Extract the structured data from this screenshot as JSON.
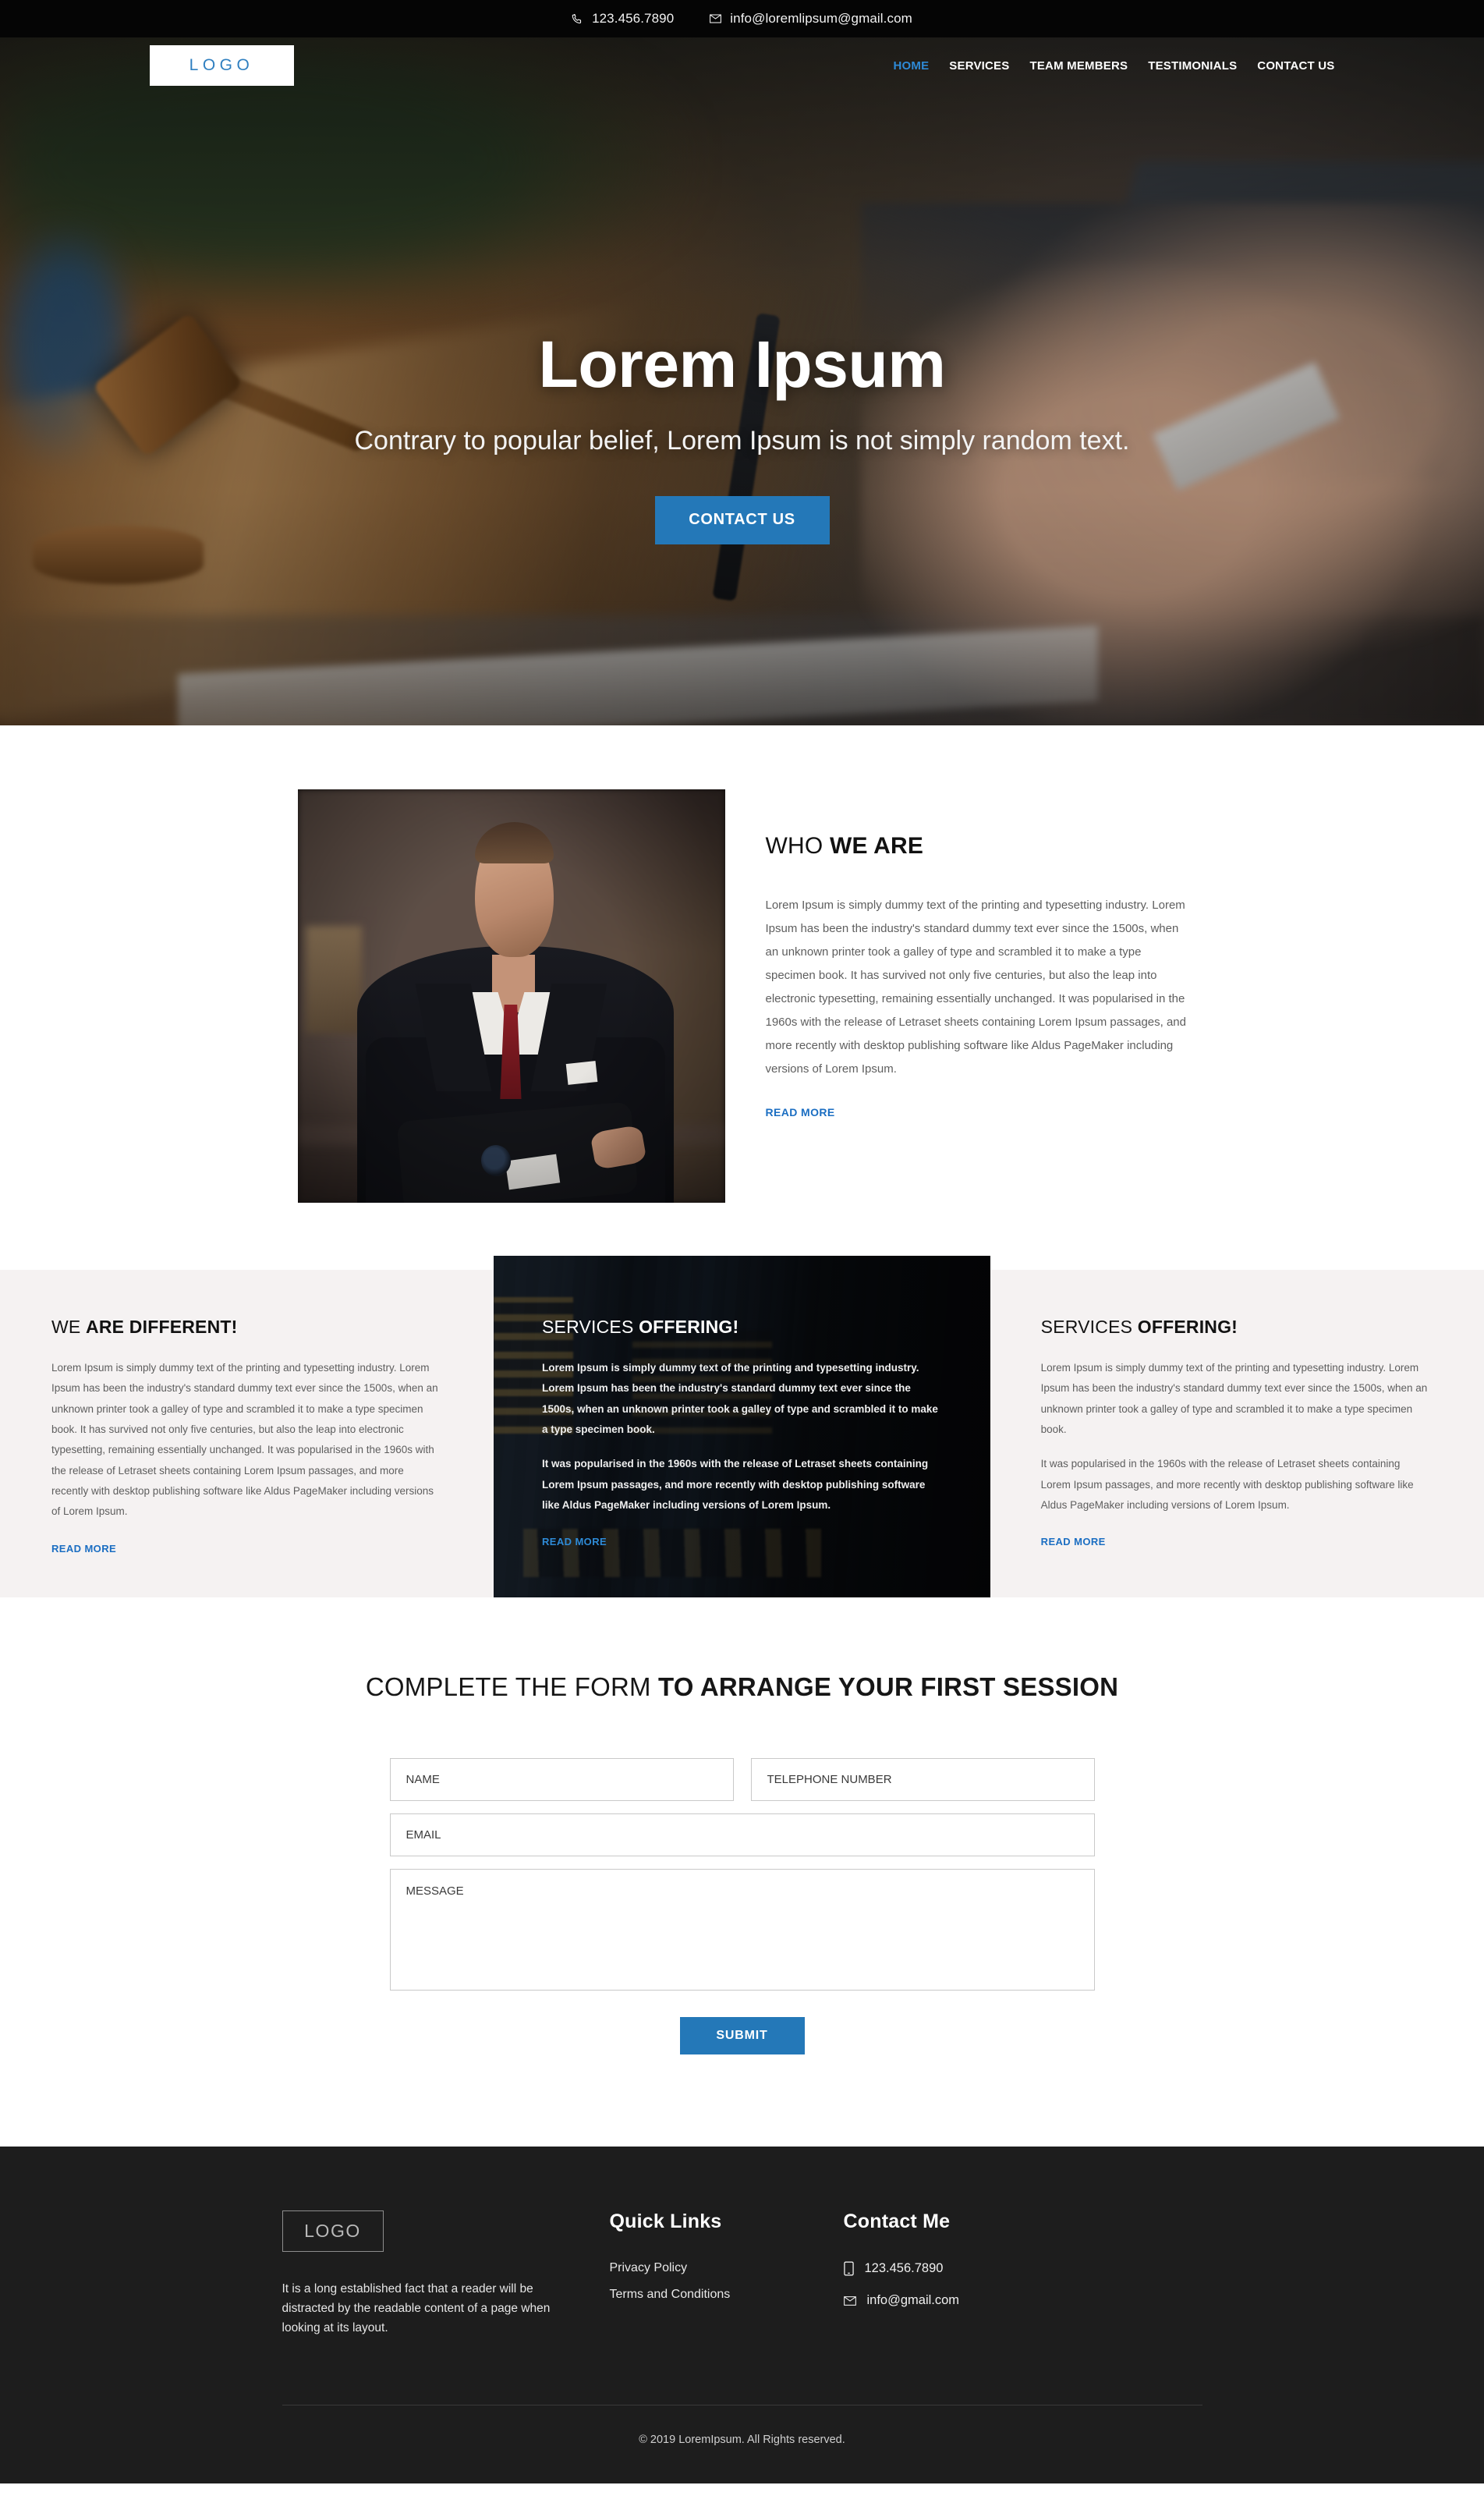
{
  "topbar": {
    "phone": "123.456.7890",
    "email": "info@loremlipsum@gmail.com",
    "phone_icon": "phone-icon",
    "email_icon": "envelope-icon"
  },
  "nav": {
    "logo": "LOGO",
    "items": [
      {
        "label": "HOME",
        "active": true
      },
      {
        "label": "SERVICES",
        "active": false
      },
      {
        "label": "TEAM MEMBERS",
        "active": false
      },
      {
        "label": "TESTIMONIALS",
        "active": false
      },
      {
        "label": "CONTACT US",
        "active": false
      }
    ]
  },
  "hero": {
    "title": "Lorem Ipsum",
    "subtitle": "Contrary to popular belief, Lorem Ipsum is not simply random text.",
    "cta_label": "CONTACT US",
    "background_image": "gavel-and-signing-hand-photo"
  },
  "about": {
    "photo": "portrait-of-lawyer-in-suit",
    "heading_light": "WHO ",
    "heading_bold": "WE ARE",
    "body": "Lorem Ipsum is simply dummy text of the printing and typesetting industry. Lorem Ipsum has been the industry's standard dummy text ever since the 1500s, when an unknown printer took a galley of type and scrambled it to make a type specimen book. It has survived not only five centuries, but also the leap into electronic typesetting, remaining essentially unchanged. It was popularised in the 1960s with the release of Letraset sheets containing Lorem Ipsum passages, and more recently with desktop publishing software like Aldus PageMaker including versions of Lorem Ipsum.",
    "read_more": "READ MORE"
  },
  "columns": [
    {
      "heading_light": "WE ",
      "heading_bold": "ARE DIFFERENT!",
      "paragraphs": [
        "Lorem Ipsum is simply dummy text of the printing and typesetting industry. Lorem Ipsum has been the industry's standard dummy text ever since the 1500s, when an unknown printer took a galley of type and scrambled it to make a type specimen book. It has survived not only five centuries, but also the leap into electronic typesetting, remaining essentially unchanged. It was popularised in the 1960s with the release of Letraset sheets containing Lorem Ipsum passages, and more recently with desktop publishing software like Aldus PageMaker including versions of Lorem Ipsum."
      ],
      "read_more": "READ MORE"
    },
    {
      "heading_light": "SERVICES ",
      "heading_bold": "OFFERING!",
      "background_image": "law-library-book-spines-photo",
      "paragraphs": [
        "Lorem Ipsum is simply dummy text of the printing and typesetting industry. Lorem Ipsum has been the industry's standard dummy text ever since the 1500s, when an unknown printer took a galley of type and scrambled it to make a type specimen book.",
        "It was popularised in the 1960s with the release of Letraset sheets containing Lorem Ipsum passages, and more recently with desktop publishing software like Aldus PageMaker including versions of Lorem Ipsum."
      ],
      "read_more": "READ MORE"
    },
    {
      "heading_light": "SERVICES ",
      "heading_bold": "OFFERING!",
      "paragraphs": [
        "Lorem Ipsum is simply dummy text of the printing and typesetting industry. Lorem Ipsum has been the industry's standard dummy text ever since the 1500s, when an unknown printer took a galley of type and scrambled it to make a type specimen book.",
        "It was popularised in the 1960s with the release of Letraset sheets containing Lorem Ipsum passages, and more recently with desktop publishing software like Aldus PageMaker including versions of Lorem Ipsum."
      ],
      "read_more": "READ MORE"
    }
  ],
  "form": {
    "title_light": "COMPLETE THE FORM ",
    "title_bold": "TO ARRANGE YOUR FIRST SESSION",
    "name_placeholder": "NAME",
    "name_value": "",
    "phone_placeholder": "TELEPHONE NUMBER",
    "phone_value": "",
    "email_placeholder": "EMAIL",
    "email_value": "",
    "message_placeholder": "MESSAGE",
    "message_value": "",
    "submit_label": "SUBMIT"
  },
  "footer": {
    "logo": "LOGO",
    "about": "It is a long established fact that a reader will be distracted by the readable content of a page when looking at its layout.",
    "quick_links_head": "Quick Links",
    "quick_links": [
      {
        "label": "Privacy Policy"
      },
      {
        "label": "Terms and Conditions"
      }
    ],
    "contact_head": "Contact Me",
    "contact_phone": "123.456.7890",
    "contact_email": "info@gmail.com",
    "contact_phone_icon": "mobile-phone-icon",
    "contact_email_icon": "envelope-icon",
    "copyright": "© 2019 LoremIpsum. All Rights reserved."
  },
  "theme": {
    "accent_blue": "#2478b8",
    "link_blue": "#1b6ec2",
    "nav_active_blue": "#2e8ad6",
    "dark_bg": "#1d1d1d",
    "light_section": "#f5f2f2",
    "topbar_bg": "#050505"
  }
}
